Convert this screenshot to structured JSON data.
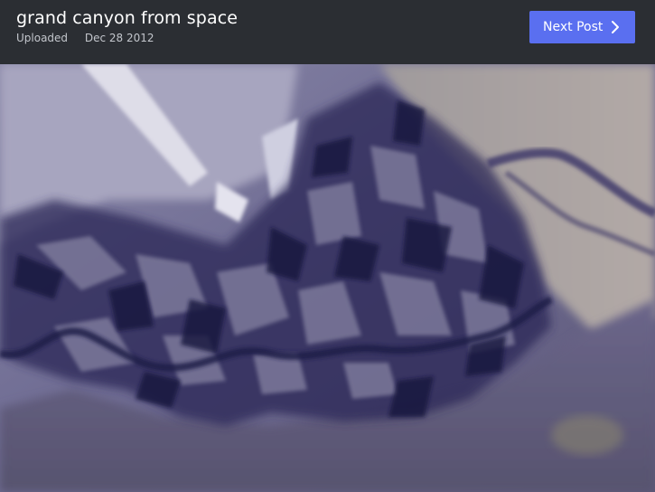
{
  "post": {
    "title": "grand canyon from space",
    "uploaded_label": "Uploaded",
    "upload_date": "Dec 28 2012"
  },
  "nav": {
    "next_label": "Next Post",
    "next_icon": "chevron-right-icon"
  },
  "colors": {
    "header_bg": "#2b2e33",
    "button_bg": "#5a6ff0",
    "title_text": "#ffffff",
    "meta_text": "#c3c6cc"
  }
}
